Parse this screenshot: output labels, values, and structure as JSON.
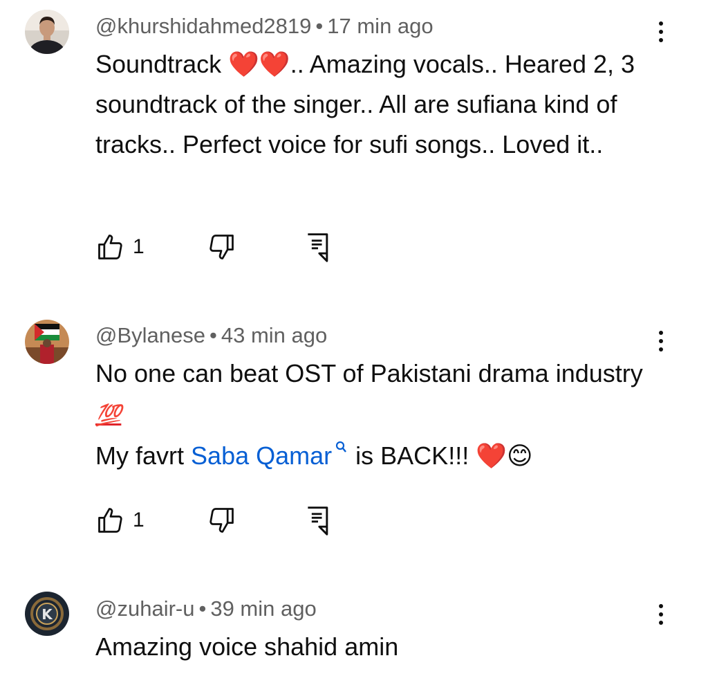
{
  "comments": [
    {
      "author": "@khurshidahmed2819",
      "separator": "•",
      "time": "17 min ago",
      "text": "Soundtrack ❤️❤️.. Amazing vocals.. Heared 2, 3 soundtrack of the singer.. All are sufiana kind of tracks.. Perfect voice for sufi songs.. Loved it..",
      "likes": "1",
      "avatar_icon": "user-photo-avatar"
    },
    {
      "author": "@Bylanese",
      "separator": "•",
      "time": "43 min ago",
      "line1": "No one can beat OST of Pakistani drama industry",
      "emoji_100": "💯",
      "line2_prefix": "My favrt",
      "link": "Saba Qamar",
      "line2_suffix": "is BACK!!!",
      "emoji_tail": "❤️😊",
      "likes": "1",
      "avatar_icon": "flag-photo-avatar"
    },
    {
      "author": "@zuhair-u",
      "separator": "•",
      "time": "39 min ago",
      "text": "Amazing voice shahid amin",
      "avatar_icon": "k-logo-avatar"
    }
  ],
  "icons": {
    "like": "thumbs-up-icon",
    "dislike": "thumbs-down-icon",
    "reply": "reply-comment-icon",
    "more": "more-vertical-icon",
    "search": "search-icon"
  },
  "colors": {
    "text": "#0f0f0f",
    "meta": "#606060",
    "link": "#065fd4"
  }
}
